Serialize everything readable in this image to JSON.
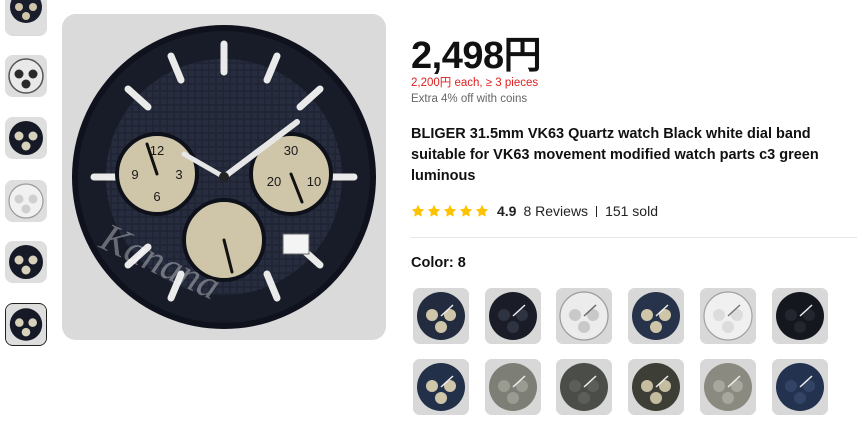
{
  "product": {
    "price": "2,498円",
    "bulk_price": "2,200円 each, ≥ 3 pieces",
    "coins_note": "Extra 4% off with coins",
    "title": "BLIGER 31.5mm VK63 Quartz watch Black white dial band suitable for VK63 movement modified watch parts c3 green luminous",
    "rating": {
      "stars": 5,
      "score": "4.9",
      "reviews": "8 Reviews",
      "sold": "151 sold"
    }
  },
  "main_image": {
    "watermark": "Kanana",
    "subdial_left": [
      "12",
      "3",
      "6",
      "9"
    ],
    "subdial_right": [
      "30",
      "10",
      "20"
    ]
  },
  "color_selector": {
    "label": "Color: 8",
    "selected_index": 0,
    "hot_icon": "fire-icon"
  },
  "thumbnails": {
    "selected_index": 5,
    "count": 6
  },
  "colors": {
    "price_red": "#e02020",
    "star_yellow": "#fdc300",
    "text_dark": "#111111",
    "dial_black": "#1d2130",
    "subdial_champagne": "#cfc6a9",
    "image_bg": "#dadada"
  }
}
